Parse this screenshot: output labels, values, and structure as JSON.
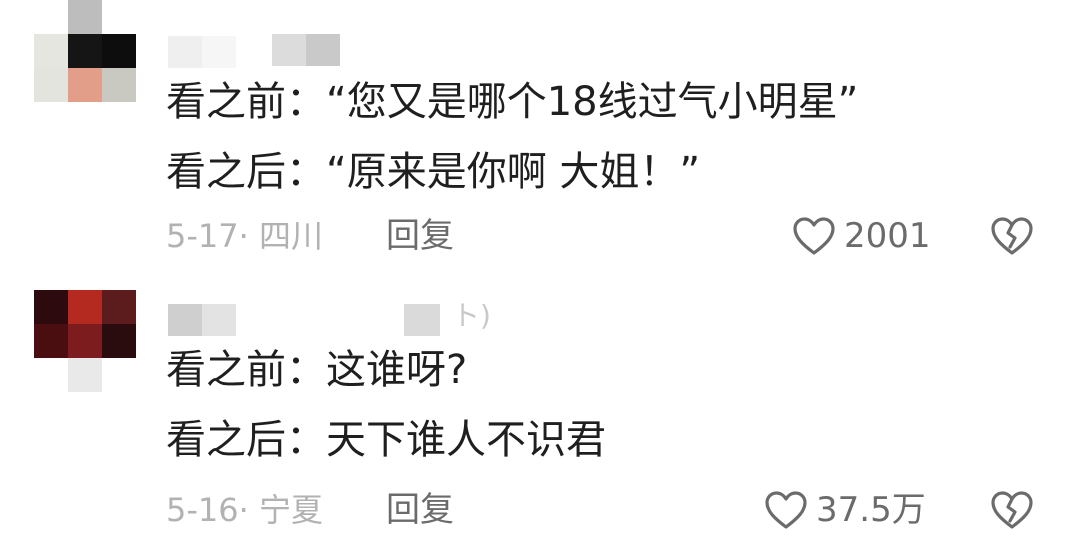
{
  "comments": [
    {
      "line1": "看之前：“您又是哪个18线过气小明星”",
      "line2": "看之后：“原来是你啊 大姐！”",
      "meta": "5-17· 四川",
      "reply_label": "回复",
      "like_count": "2001",
      "like_icon": "heart-outline",
      "dislike_icon": "broken-heart-outline"
    },
    {
      "username_tail": "ト)",
      "line1": "看之前：这谁呀?",
      "line2": "看之后：天下谁人不识君",
      "meta": "5-16· 宁夏",
      "reply_label": "回复",
      "like_count": "37.5万",
      "like_icon": "heart-outline",
      "dislike_icon": "broken-heart-outline"
    }
  ],
  "colors": {
    "text": "#1f1f1f",
    "meta": "#b2b2b2",
    "action": "#6b6b6b"
  }
}
